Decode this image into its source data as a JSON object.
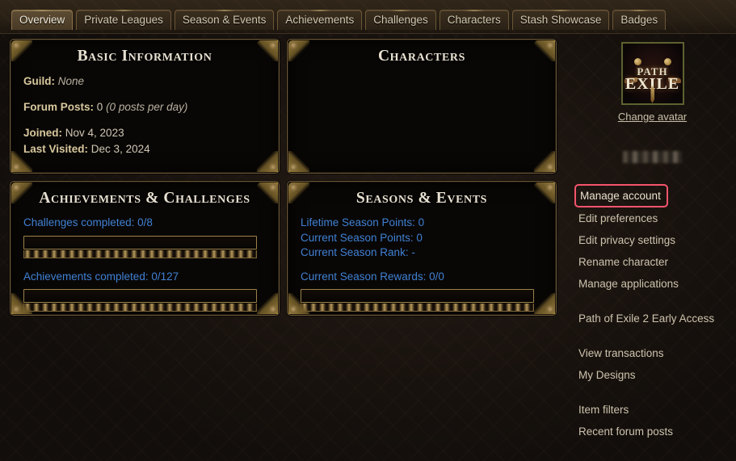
{
  "tabs": [
    {
      "label": "Overview",
      "active": true
    },
    {
      "label": "Private Leagues",
      "active": false
    },
    {
      "label": "Season & Events",
      "active": false
    },
    {
      "label": "Achievements",
      "active": false
    },
    {
      "label": "Challenges",
      "active": false
    },
    {
      "label": "Characters",
      "active": false
    },
    {
      "label": "Stash Showcase",
      "active": false
    },
    {
      "label": "Badges",
      "active": false
    }
  ],
  "panels": {
    "basic_information": {
      "title": "Basic Information",
      "guild_label": "Guild:",
      "guild_value": "None",
      "forum_posts_label": "Forum Posts:",
      "forum_posts_value": "0",
      "forum_posts_rate": "(0 posts per day)",
      "joined_label": "Joined:",
      "joined_value": "Nov 4, 2023",
      "last_visited_label": "Last Visited:",
      "last_visited_value": "Dec 3, 2024"
    },
    "characters": {
      "title": "Characters",
      "empty_message": ""
    },
    "achievements_challenges": {
      "title": "Achievements & Challenges",
      "challenges_label": "Challenges completed: 0/8",
      "challenges_completed": 0,
      "challenges_total": 8,
      "challenges_percent": 0,
      "achievements_label": "Achievements completed: 0/127",
      "achievements_completed": 0,
      "achievements_total": 127,
      "achievements_percent": 0
    },
    "seasons_events": {
      "title": "Seasons & Events",
      "lifetime_points_label": "Lifetime Season Points: 0",
      "current_points_label": "Current Season Points: 0",
      "current_rank_label": "Current Season Rank: -",
      "current_rewards_label": "Current Season Rewards: 0/0",
      "rewards_percent": 0
    }
  },
  "sidebar": {
    "avatar": {
      "icon": "path-of-exile-logo",
      "logo_top": "PATH",
      "logo_bottom": "EXILE"
    },
    "change_avatar_label": "Change avatar",
    "username_redacted": true,
    "userid_redacted": true,
    "menu": [
      {
        "label": "Manage account",
        "highlighted": true,
        "gap_above": false
      },
      {
        "label": "Edit preferences",
        "highlighted": false,
        "gap_above": false
      },
      {
        "label": "Edit privacy settings",
        "highlighted": false,
        "gap_above": false
      },
      {
        "label": "Rename character",
        "highlighted": false,
        "gap_above": false
      },
      {
        "label": "Manage applications",
        "highlighted": false,
        "gap_above": false
      },
      {
        "label": "Path of Exile 2 Early Access",
        "highlighted": false,
        "gap_above": true
      },
      {
        "label": "View transactions",
        "highlighted": false,
        "gap_above": true
      },
      {
        "label": "My Designs",
        "highlighted": false,
        "gap_above": false
      },
      {
        "label": "Item filters",
        "highlighted": false,
        "gap_above": true
      },
      {
        "label": "Recent forum posts",
        "highlighted": false,
        "gap_above": false
      }
    ]
  },
  "colors": {
    "highlight_box": "#f4546c",
    "link_blue": "#3f80d4",
    "panel_border_gold": "#6d5a38",
    "title_text": "#e8e1d2",
    "label_gold": "#d8c89e"
  }
}
